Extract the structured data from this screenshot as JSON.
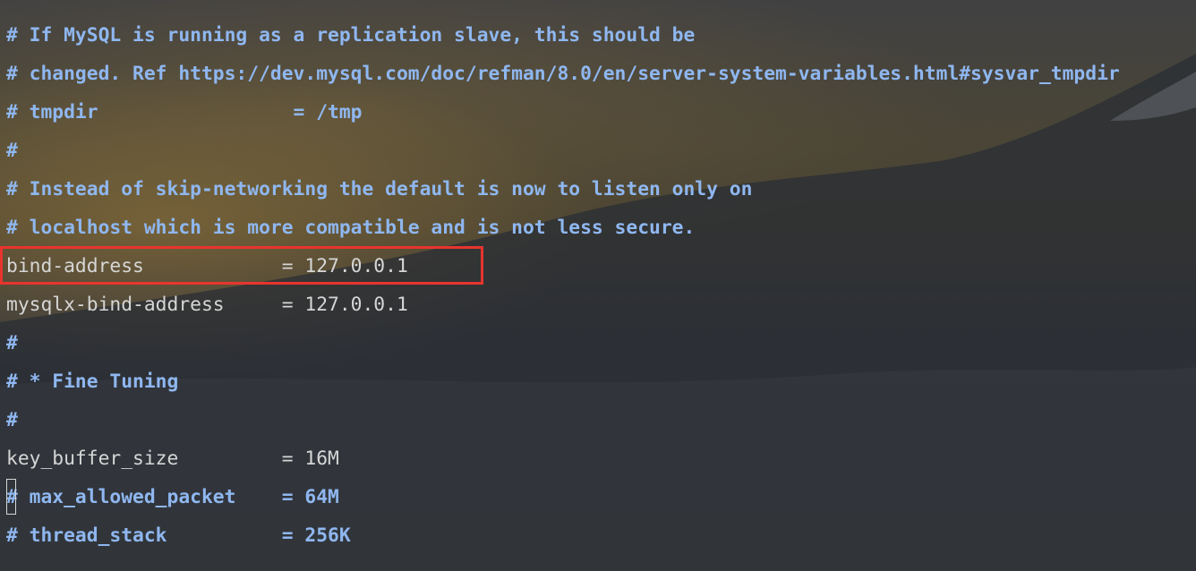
{
  "editor": {
    "lines": [
      {
        "text": "# If MySQL is running as a replication slave, this should be",
        "kind": "comment"
      },
      {
        "text": "# changed. Ref https://dev.mysql.com/doc/refman/8.0/en/server-system-variables.html#sysvar_tmpdir",
        "kind": "comment"
      },
      {
        "text": "# tmpdir                 = /tmp",
        "kind": "comment"
      },
      {
        "text": "#",
        "kind": "comment"
      },
      {
        "text": "# Instead of skip-networking the default is now to listen only on",
        "kind": "comment"
      },
      {
        "text": "# localhost which is more compatible and is not less secure.",
        "kind": "comment"
      },
      {
        "text": "bind-address            = 127.0.0.1",
        "kind": "code"
      },
      {
        "text": "mysqlx-bind-address     = 127.0.0.1",
        "kind": "code"
      },
      {
        "text": "#",
        "kind": "comment"
      },
      {
        "text": "# * Fine Tuning",
        "kind": "comment"
      },
      {
        "text": "#",
        "kind": "comment"
      },
      {
        "text": "key_buffer_size         = 16M",
        "kind": "code"
      },
      {
        "text": "# max_allowed_packet    = 64M",
        "kind": "comment"
      },
      {
        "text": "# thread_stack          = 256K",
        "kind": "comment"
      }
    ],
    "highlighted_line": "bind-address",
    "cursor_line": 13
  },
  "colors": {
    "comment": "#8fb7f0",
    "code": "#d6d6d6",
    "highlight": "#e8342e"
  }
}
